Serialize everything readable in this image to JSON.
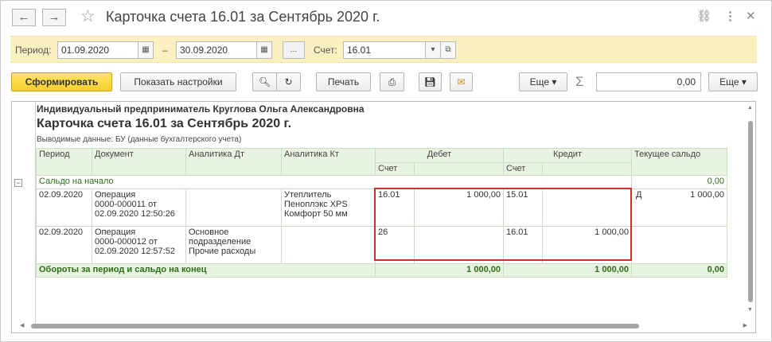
{
  "window": {
    "title": "Карточка счета 16.01 за Сентябрь 2020 г.",
    "back_icon": "←",
    "forward_icon": "→"
  },
  "filters": {
    "period_label": "Период:",
    "date_from": "01.09.2020",
    "dash": "–",
    "date_to": "30.09.2020",
    "ellipsis": "...",
    "account_label": "Счет:",
    "account": "16.01"
  },
  "toolbar": {
    "generate": "Сформировать",
    "show_settings": "Показать настройки",
    "print": "Печать",
    "more1": "Еще ▾",
    "sum_value": "0,00",
    "more2": "Еще ▾"
  },
  "report": {
    "org": "Индивидуальный предприниматель Круглова Ольга Александровна",
    "title": "Карточка счета 16.01 за Сентябрь 2020 г.",
    "output_data": "Выводимые данные:  БУ (данные бухгалтерского учета)",
    "headers": {
      "period": "Период",
      "document": "Документ",
      "analytics_dt": "Аналитика Дт",
      "analytics_kt": "Аналитика Кт",
      "debit": "Дебет",
      "credit": "Кредит",
      "balance": "Текущее сальдо",
      "account": "Счет",
      "account2": "Счет"
    },
    "opening": {
      "label": "Сальдо на начало",
      "value": "0,00"
    },
    "rows": [
      {
        "period": "02.09.2020",
        "doc1": "Операция",
        "doc2": "0000-000011 от",
        "doc3": "02.09.2020 12:50:26",
        "dt1": "",
        "dt2": "",
        "dt3": "",
        "kt1": "Утеплитель",
        "kt2": "Пеноплэкс XPS",
        "kt3": "Комфорт 50 мм",
        "debit_account": "16.01",
        "debit_sum": "1 000,00",
        "credit_account": "15.01",
        "credit_sum": "",
        "balance_side": "Д",
        "balance_sum": "1 000,00"
      },
      {
        "period": "02.09.2020",
        "doc1": "Операция",
        "doc2": "0000-000012 от",
        "doc3": "02.09.2020 12:57:52",
        "dt1": "Основное",
        "dt2": "подразделение",
        "dt3": "Прочие расходы",
        "kt1": "",
        "kt2": "",
        "kt3": "",
        "debit_account": "26",
        "debit_sum": "",
        "credit_account": "16.01",
        "credit_sum": "1 000,00",
        "balance_side": "",
        "balance_sum": ""
      }
    ],
    "totals": {
      "label": "Обороты за период и сальдо на конец",
      "debit": "1 000,00",
      "credit": "1 000,00",
      "balance": "0,00"
    }
  },
  "colors": {
    "accent_yellow": "#f7cf2b",
    "filter_bg": "#fbf1c0",
    "table_green": "#e9f3e2",
    "highlight_red": "#d42b2b"
  }
}
